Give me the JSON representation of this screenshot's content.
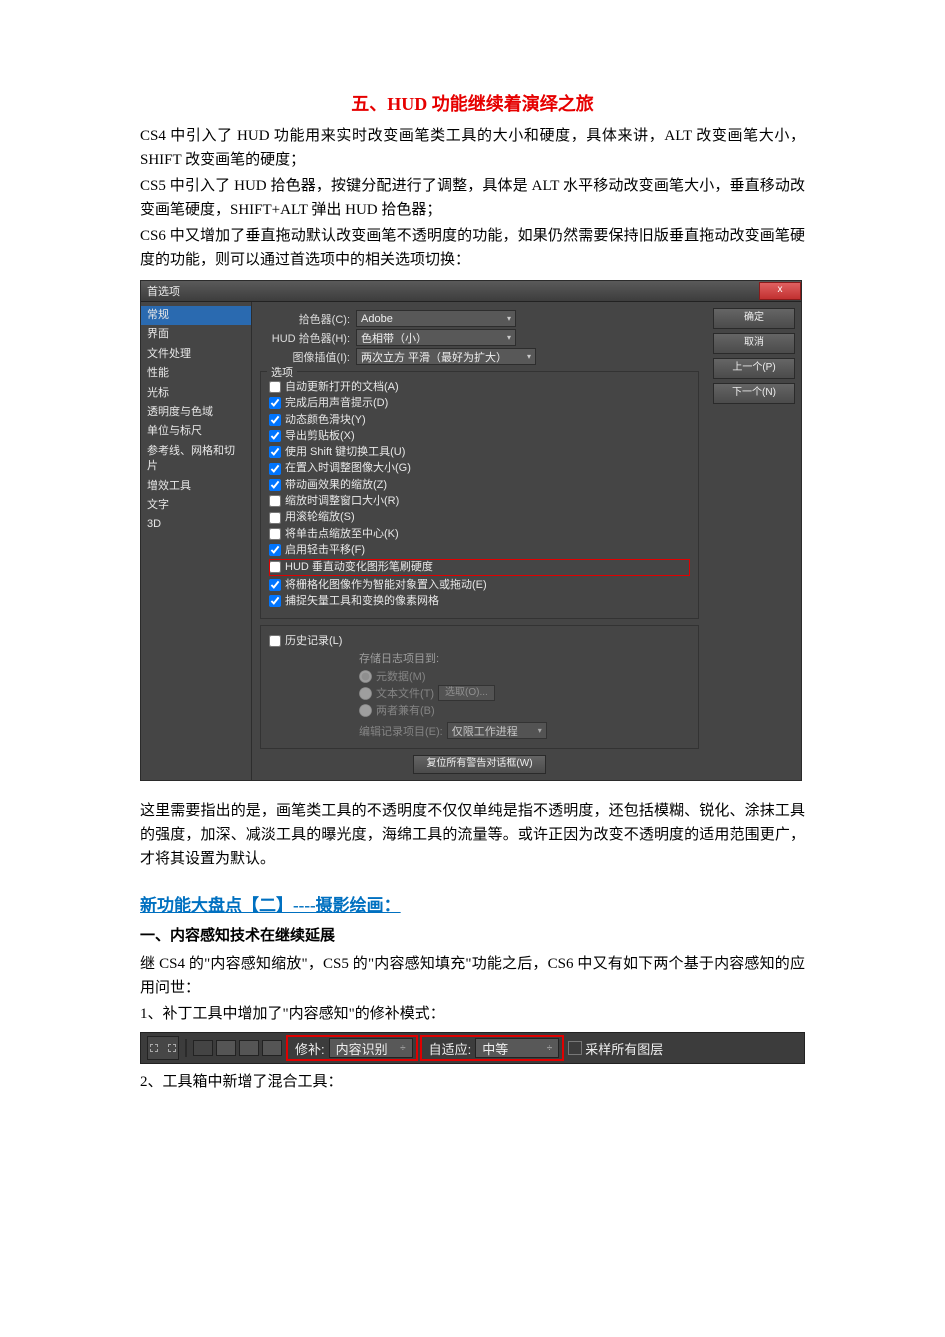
{
  "title": {
    "prefix": "五、",
    "mid": "HUD",
    "suffix": " 功能继续着演绎之旅"
  },
  "paras": {
    "p1": "CS4 中引入了 HUD 功能用来实时改变画笔类工具的大小和硬度，具体来讲，ALT 改变画笔大小，SHIFT 改变画笔的硬度；",
    "p2": "CS5 中引入了 HUD 拾色器，按键分配进行了调整，具体是 ALT 水平移动改变画笔大小，垂直移动改变画笔硬度，SHIFT+ALT 弹出 HUD 拾色器；",
    "p3": "CS6 中又增加了垂直拖动默认改变画笔不透明度的功能，如果仍然需要保持旧版垂直拖动改变画笔硬度的功能，则可以通过首选项中的相关选项切换："
  },
  "dialog": {
    "title": "首选项",
    "close": "x",
    "btns": {
      "ok": "确定",
      "cancel": "取消",
      "prev": "上一个(P)",
      "next": "下一个(N)"
    },
    "sidebar": [
      "常规",
      "界面",
      "文件处理",
      "性能",
      "光标",
      "透明度与色域",
      "单位与标尺",
      "参考线、网格和切片",
      "增效工具",
      "文字",
      "3D"
    ],
    "labels": {
      "picker": "拾色器(C):",
      "hud": "HUD 拾色器(H):",
      "interp": "图像插值(I):"
    },
    "picker_val": "Adobe",
    "hud_val": "色相带（小）",
    "interp_val": "两次立方 平滑（最好为扩大）",
    "options_legend": "选项",
    "opts": [
      {
        "c": false,
        "t": "自动更新打开的文档(A)"
      },
      {
        "c": true,
        "t": "完成后用声音提示(D)"
      },
      {
        "c": true,
        "t": "动态颜色滑块(Y)"
      },
      {
        "c": true,
        "t": "导出剪贴板(X)"
      },
      {
        "c": true,
        "t": "使用 Shift 键切换工具(U)"
      },
      {
        "c": true,
        "t": "在置入时调整图像大小(G)"
      },
      {
        "c": true,
        "t": "带动画效果的缩放(Z)"
      },
      {
        "c": false,
        "t": "缩放时调整窗口大小(R)"
      },
      {
        "c": false,
        "t": "用滚轮缩放(S)"
      },
      {
        "c": false,
        "t": "将单击点缩放至中心(K)"
      },
      {
        "c": true,
        "t": "启用轻击平移(F)"
      },
      {
        "c": false,
        "t": "HUD 垂直动变化图形笔刷硬度",
        "hl": true
      },
      {
        "c": true,
        "t": "将栅格化图像作为智能对象置入或拖动(E)"
      },
      {
        "c": true,
        "t": "捕捉矢量工具和变换的像素网格"
      }
    ],
    "history_legend": "历史记录(L)",
    "history_save": "存储日志项目到:",
    "radios": {
      "meta": "元数据(M)",
      "txt": "文本文件(T)",
      "both": "两者兼有(B)"
    },
    "choose": "选取(O)...",
    "edit_log": "编辑记录项目(E):",
    "edit_log_val": "仅限工作进程",
    "reset": "复位所有警告对话框(W)"
  },
  "after": {
    "p4": "这里需要指出的是，画笔类工具的不透明度不仅仅单纯是指不透明度，还包括模糊、锐化、涂抹工具的强度，加深、减淡工具的曝光度，海绵工具的流量等。或许正因为改变不透明度的适用范围更广，才将其设置为默认。"
  },
  "section2": {
    "h": "新功能大盘点【二】----摄影绘画：",
    "sub": "一、内容感知技术在继续延展",
    "p5": "继 CS4 的\"内容感知缩放\"，CS5 的\"内容感知填充\"功能之后，CS6 中又有如下两个基于内容感知的应用问世：",
    "p6": "1、补丁工具中增加了\"内容感知\"的修补模式：",
    "p7": "2、工具箱中新增了混合工具："
  },
  "toolbar": {
    "fix_label": "修补:",
    "fix_val": "内容识别",
    "adapt_label": "自适应:",
    "adapt_val": "中等",
    "sample": "采样所有图层"
  }
}
